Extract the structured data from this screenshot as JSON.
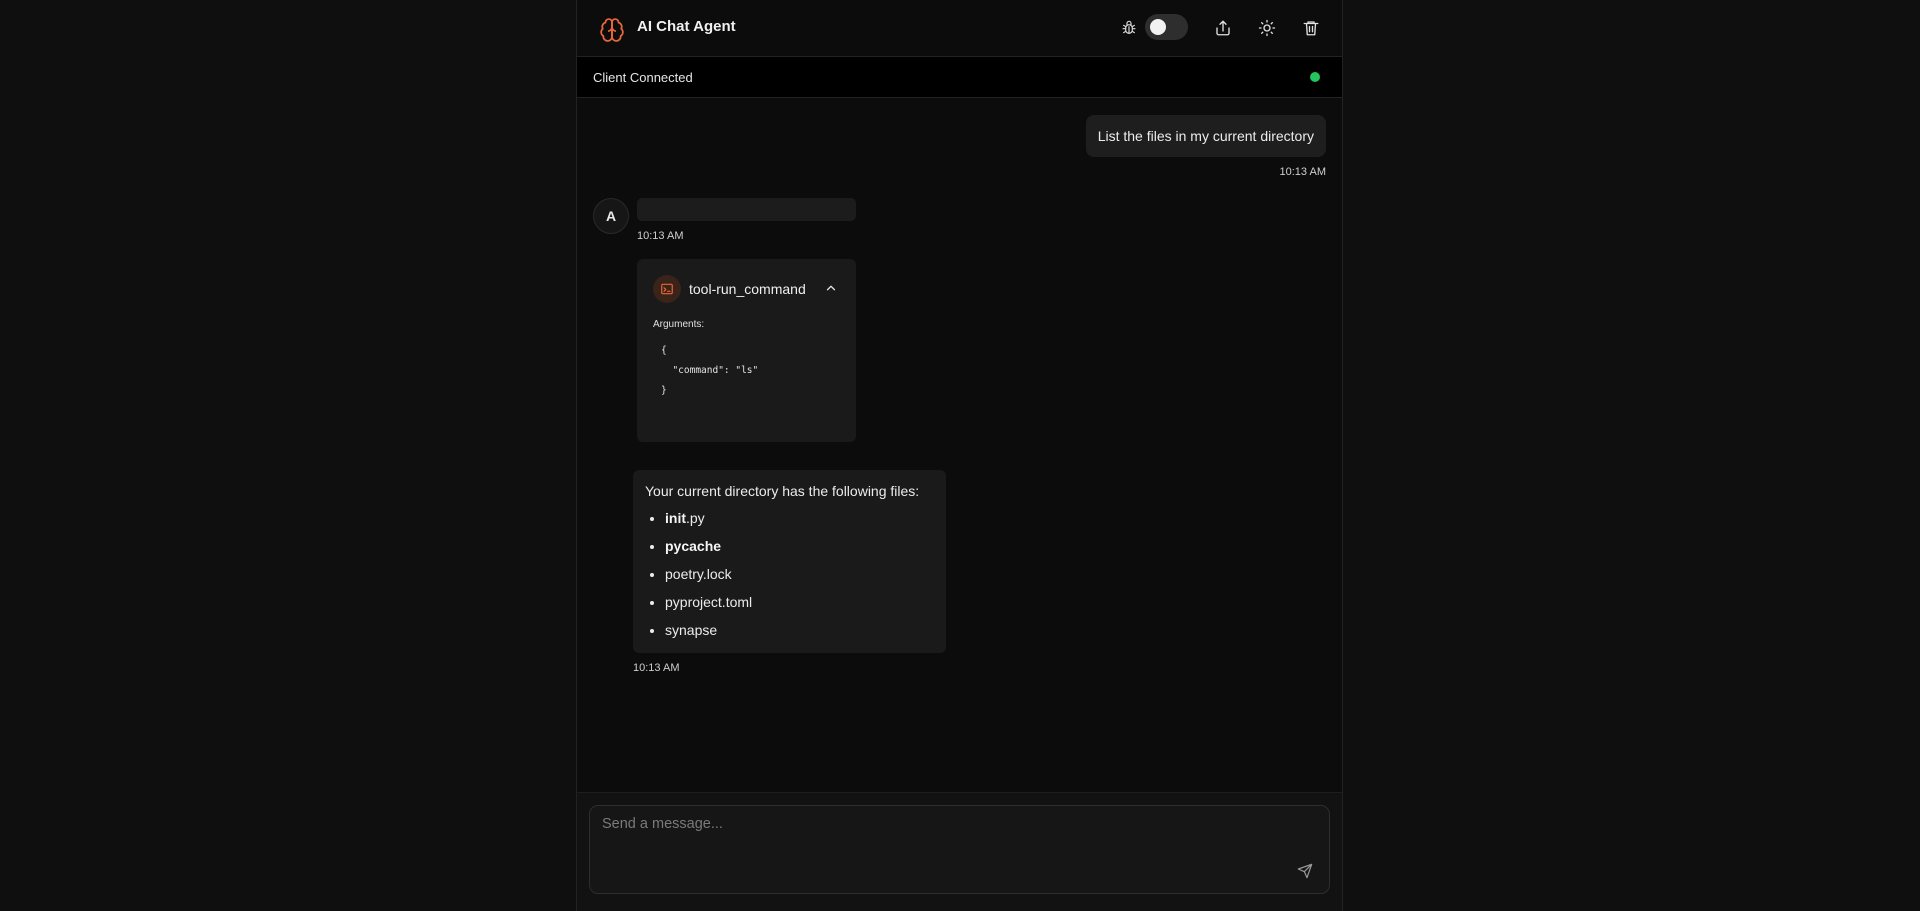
{
  "header": {
    "title": "AI Chat Agent",
    "brand_icon": "brain-icon",
    "accent_color": "#e8673a",
    "debug_toggle_on": false
  },
  "status": {
    "text": "Client Connected",
    "dot_color": "#22c55e"
  },
  "messages": {
    "user": {
      "text": "List the files in my current directory",
      "time": "10:13 AM"
    },
    "assistant": {
      "avatar": "A",
      "time": "10:13 AM"
    },
    "tool": {
      "name": "tool-run_command",
      "args_label": "Arguments:",
      "args_code": "{\n  \"command\": \"ls\"\n}"
    },
    "reply": {
      "intro": "Your current directory has the following files:",
      "items": [
        {
          "bold": "init",
          "rest": ".py"
        },
        {
          "bold": "pycache",
          "rest": ""
        },
        {
          "bold": "",
          "rest": "poetry.lock"
        },
        {
          "bold": "",
          "rest": "pyproject.toml"
        },
        {
          "bold": "",
          "rest": "synapse"
        }
      ],
      "time": "10:13 AM"
    }
  },
  "composer": {
    "placeholder": "Send a message..."
  }
}
